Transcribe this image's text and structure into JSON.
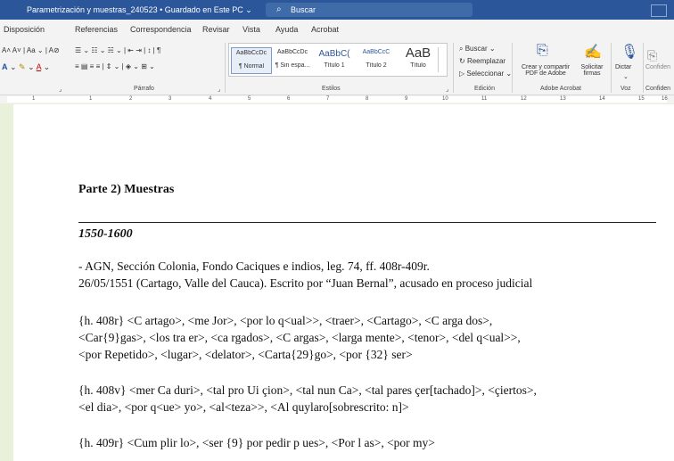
{
  "window": {
    "title": "Parametrización y muestras_240523 • Guardado en Este PC ⌄",
    "search_placeholder": "Buscar"
  },
  "menu": [
    "Disposición",
    "Referencias",
    "Correspondencia",
    "Revisar",
    "Vista",
    "Ayuda",
    "Acrobat"
  ],
  "ribbon": {
    "groups": {
      "paragraph": "Párrafo",
      "styles": "Estilos",
      "editing": "Edición",
      "acrobat": "Adobe Acrobat",
      "voice": "Voz",
      "confidential": "Confiden"
    },
    "styles": [
      {
        "preview": "AaBbCcDc",
        "name": "¶ Normal"
      },
      {
        "preview": "AaBbCcDc",
        "name": "¶ Sin espa..."
      },
      {
        "preview": "AaBbC(",
        "name": "Título 1"
      },
      {
        "preview": "AaBbCcC",
        "name": "Título 2"
      },
      {
        "preview": "AaB",
        "name": "Título"
      }
    ],
    "editing": {
      "find": "Buscar ⌄",
      "replace": "Reemplazar",
      "select": "Seleccionar ⌄"
    },
    "acrobat": {
      "create": "Crear y compartir\nPDF de Adobe",
      "request": "Solicitar\nfirmas"
    },
    "voice": {
      "dictate": "Dictar"
    },
    "confidential_btn": "Confiden"
  },
  "ruler": {
    "numbers": [
      "1",
      "1",
      "2",
      "3",
      "4",
      "5",
      "6",
      "7",
      "8",
      "9",
      "10",
      "11",
      "12",
      "13",
      "14",
      "15",
      "16"
    ]
  },
  "document": {
    "heading": "Parte 2) Muestras",
    "date_range": "1550-1600",
    "source_line": "- AGN, Sección Colonia, Fondo Caciques e indios, leg. 74, ff. 408r-409r.",
    "context_line": "26/05/1551 (Cartago, Valle del Cauca). Escrito por “Juan Bernal”, acusado en proceso judicial",
    "p408r": "{h. 408r} <C artago>, <me Jor>, <por lo q<ual>>, <traer>, <Cartago>, <C arga dos>,\n<Car{9}gas>, <los tra er>, <ca rgados>, <C argas>, <larga mente>, <tenor>, <del q<ual>>,\n<por Repetido>, <lugar>, <delator>, <Carta{29}go>, <por {32} ser>",
    "p408v": "{h. 408v} <mer Ca duri>, <tal pro Ui çion>, <tal nun Ca>, <tal pares çer[tachado]>, <çiertos>,\n<el dia>, <por q<ue> yo>, <al<teza>>, <Al quylaro[sobrescrito: n]>",
    "p409r": "{h. 409r} <Cum plir lo>, <ser {9} por pedir p ues>, <Por l as>, <por my>"
  }
}
